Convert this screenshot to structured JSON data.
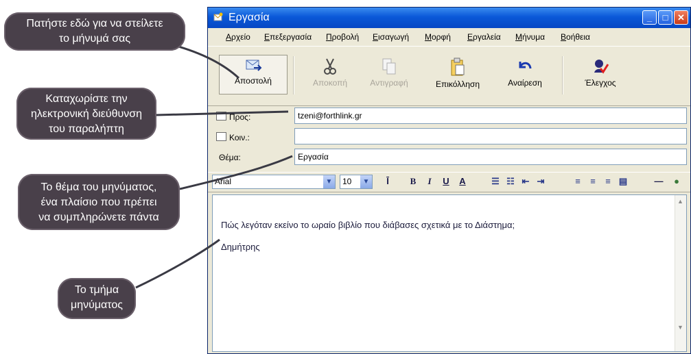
{
  "window": {
    "title": "Εργασία",
    "menu": [
      "Αρχείο",
      "Επεξεργασία",
      "Προβολή",
      "Εισαγωγή",
      "Μορφή",
      "Εργαλεία",
      "Μήνυμα",
      "Βοήθεια"
    ],
    "toolbar": [
      {
        "label": "Αποστολή",
        "icon": "send-icon",
        "enabled": true
      },
      {
        "label": "Αποκοπή",
        "icon": "scissors-icon",
        "enabled": false
      },
      {
        "label": "Αντιγραφή",
        "icon": "copy-icon",
        "enabled": false
      },
      {
        "label": "Επικόλληση",
        "icon": "paste-icon",
        "enabled": true
      },
      {
        "label": "Αναίρεση",
        "icon": "undo-icon",
        "enabled": true
      },
      {
        "label": "Έλεγχος",
        "icon": "spellcheck-icon",
        "enabled": true
      }
    ],
    "fields": {
      "to_label": "Προς:",
      "to_value": "tzeni@forthlink.gr",
      "cc_label": "Κοιν.:",
      "cc_value": "",
      "subject_label": "Θέμα:",
      "subject_value": "Εργασία"
    },
    "format": {
      "font": "Arial",
      "size": "10"
    },
    "body": {
      "line1": "Πώς λεγόταν εκείνο το ωραίο βιβλίο που διάβασες σχετικά με το Διάστημα;",
      "line2": "Δημήτρης"
    }
  },
  "callouts": {
    "send": [
      "Πατήστε εδώ για να στείλετε",
      "το μήνυμά σας"
    ],
    "address": [
      "Καταχωρίστε την",
      "ηλεκτρονική διεύθυνση",
      "του παραλήπτη"
    ],
    "subject": [
      "Το θέμα του μηνύματος,",
      "ένα πλαίσιο που πρέπει",
      "να συμπληρώνετε πάντα"
    ],
    "body": [
      "Το τμήμα",
      "μηνύματος"
    ]
  },
  "colors": {
    "titlebar": "#0a58d8",
    "window_bg": "#ece9d8",
    "callout_bg": "#49404a"
  }
}
